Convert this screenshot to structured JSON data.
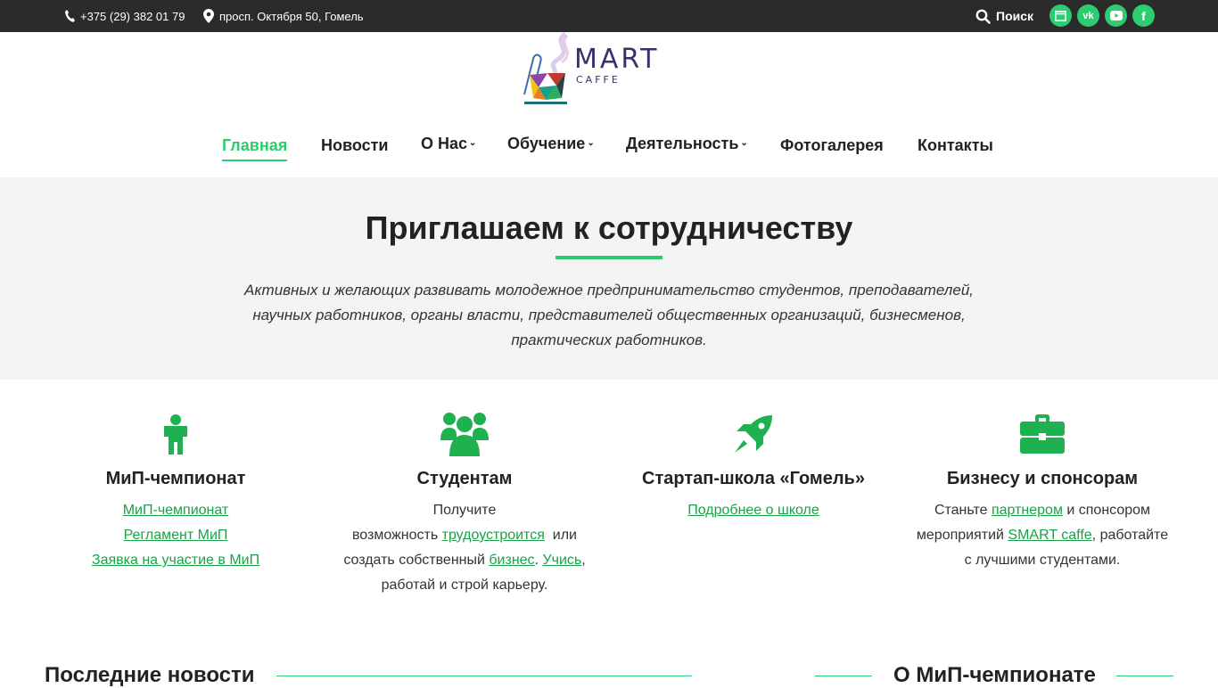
{
  "topbar": {
    "phone": "+375 (29) 382 01 79",
    "address": "просп. Октября 50, Гомель",
    "search_label": "Поиск",
    "social": [
      {
        "name": "browser",
        "glyph": ""
      },
      {
        "name": "vk",
        "glyph": "vk"
      },
      {
        "name": "youtube",
        "glyph": ""
      },
      {
        "name": "facebook",
        "glyph": "f"
      }
    ]
  },
  "logo": {
    "text_main": "MART",
    "text_sub": "CAFFE"
  },
  "nav": {
    "items": [
      {
        "label": "Главная",
        "active": true
      },
      {
        "label": "Новости"
      },
      {
        "label": "О Нас",
        "caret": "⌄"
      },
      {
        "label": "Обучение",
        "caret": "⌄"
      },
      {
        "label": "Деятельность",
        "caret": "⌄"
      },
      {
        "label": "Фотогалерея"
      },
      {
        "label": "Контакты"
      }
    ]
  },
  "invite": {
    "title": "Приглашаем к сотрудничеству",
    "text_lines": [
      "Активных и желающих развивать молодежное предпринимательство студентов, преподавателей,",
      "научных работников, органы власти, представителей общественных организаций, бизнесменов,",
      "практических работников."
    ]
  },
  "features": [
    {
      "title": "МиП-чемпионат",
      "links": [
        "МиП-чемпионат",
        "Регламент МиП",
        "Заявка на участие в МиП"
      ]
    },
    {
      "title": "Студентам",
      "l1": "Получите",
      "l2_a": "возможность ",
      "l2_link": "трудоустроится",
      "l2_b": "  или",
      "l3_a": "создать собственный ",
      "l3_link1": "бизнес",
      "l3_b": ". ",
      "l3_link2": "Учись",
      "l3_c": ",",
      "l4": "работай и строй карьеру."
    },
    {
      "title": "Стартап-школа «Гомель»",
      "link": "Подробнее о школе"
    },
    {
      "title": "Бизнесу и спонсорам",
      "l1_a": "Станьте ",
      "l1_link": "партнером",
      "l1_b": " и спонсором",
      "l2_a": "мероприятий ",
      "l2_link": "SMART caffe",
      "l2_b": ", работайте",
      "l3": "с лучшими студентами."
    }
  ],
  "sections": {
    "news_title": "Последние новости",
    "about_title": "О МиП-чемпионате"
  },
  "colors": {
    "accent": "#2ecc71",
    "link": "#1aa24a",
    "topbar": "#2b2b2b",
    "band": "#f4f4f4"
  }
}
